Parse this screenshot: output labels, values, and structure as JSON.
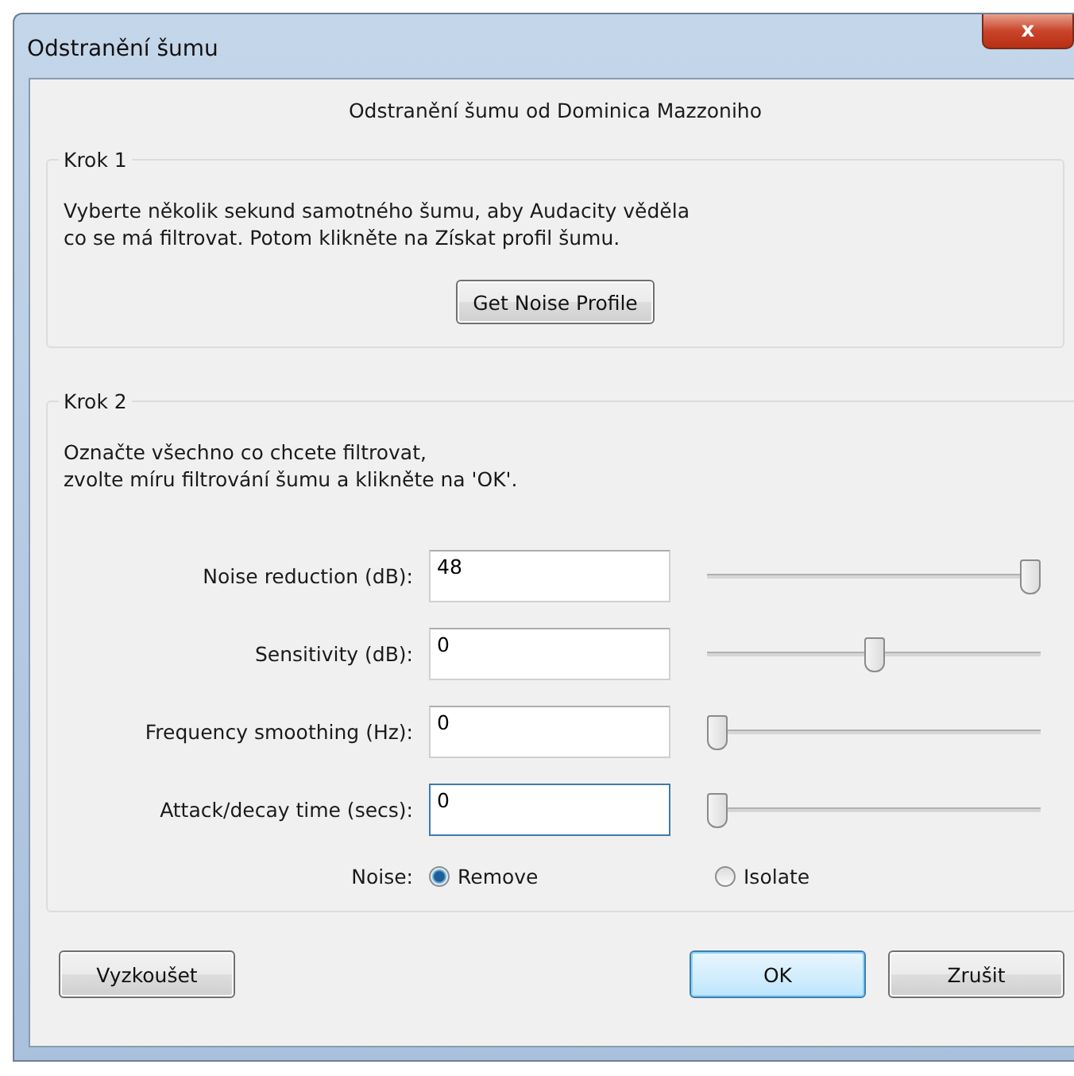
{
  "window": {
    "title": "Odstranění šumu",
    "close": "x"
  },
  "heading": "Odstranění šumu od Dominica Mazzoniho",
  "step1": {
    "title": "Krok 1",
    "text": "Vyberte několik sekund samotného šumu, aby Audacity věděla\nco se má filtrovat. Potom klikněte na Získat profil šumu.",
    "button": "Get Noise Profile"
  },
  "step2": {
    "title": "Krok 2",
    "text": "Označte všechno co chcete filtrovat,\nzvolte míru filtrování šumu a klikněte na 'OK'.",
    "settings": [
      {
        "label": "Noise reduction (dB):",
        "value": "48",
        "level": 1.0,
        "focused": false
      },
      {
        "label": "Sensitivity (dB):",
        "value": "0",
        "level": 0.5,
        "focused": false
      },
      {
        "label": "Frequency smoothing (Hz):",
        "value": "0",
        "level": 0,
        "focused": false
      },
      {
        "label": "Attack/decay time (secs):",
        "value": "0",
        "level": 0,
        "focused": true
      }
    ],
    "noise": {
      "label": "Noise:",
      "options": [
        {
          "label": "Remove",
          "selected": true
        },
        {
          "label": "Isolate",
          "selected": false
        }
      ]
    }
  },
  "buttons": [
    {
      "label": "Vyzkoušet",
      "kind": "secondary"
    },
    {
      "label": "OK",
      "kind": "default"
    },
    {
      "label": "Zrušit",
      "kind": "secondary"
    }
  ]
}
